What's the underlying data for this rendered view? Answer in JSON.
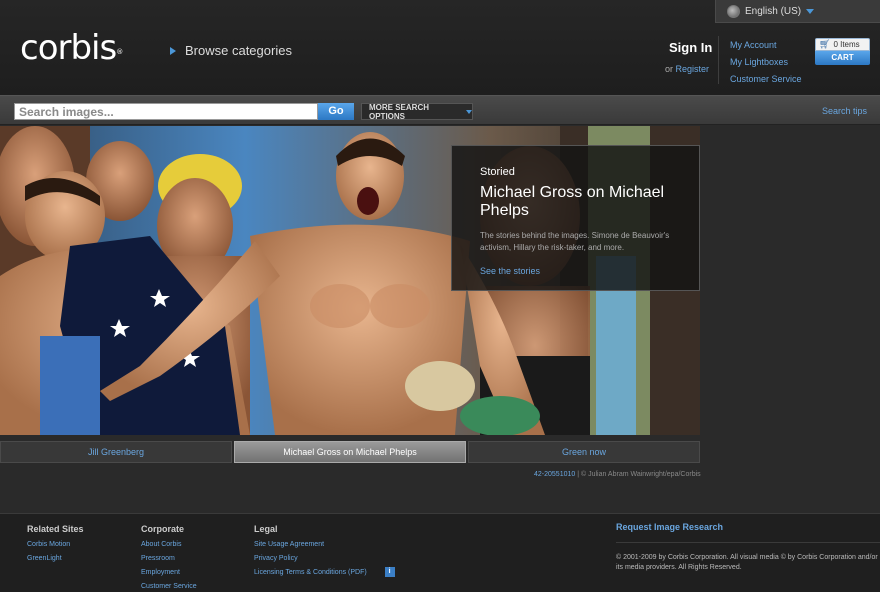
{
  "header": {
    "language": "English (US)",
    "logo_text": "corbis",
    "logo_mark": "®",
    "browse": "Browse categories",
    "sign_in": "Sign In",
    "or": "or",
    "register": "Register",
    "account_links": [
      "My Account",
      "My Lightboxes",
      "Customer Service"
    ],
    "cart_items": "0 Items",
    "cart_label": "CART"
  },
  "search": {
    "placeholder": "Search images...",
    "go": "Go",
    "more_options": "MORE SEARCH OPTIONS",
    "tips": "Search tips"
  },
  "hero": {
    "kicker": "Storied",
    "title": "Michael Gross on Michael Phelps",
    "description": "The stories behind the images. Simone de Beauvoir's activism, Hillary the risk-taker, and more.",
    "link": "See the stories"
  },
  "tabs": [
    {
      "label": "Jill Greenberg",
      "active": false
    },
    {
      "label": "Michael Gross on Michael Phelps",
      "active": true
    },
    {
      "label": "Green now",
      "active": false
    }
  ],
  "credit": {
    "id": "42-20551010",
    "text": " | © Julian Abram Wainwright/epa/Corbis"
  },
  "footer": {
    "related": {
      "heading": "Related Sites",
      "links": [
        "Corbis Motion",
        "GreenLight"
      ]
    },
    "corporate": {
      "heading": "Corporate",
      "links": [
        "About Corbis",
        "Pressroom",
        "Employment",
        "Customer Service"
      ]
    },
    "legal": {
      "heading": "Legal",
      "links": [
        "Site Usage Agreement",
        "Privacy Policy",
        "Licensing Terms & Conditions (PDF)"
      ],
      "info_icon": "i"
    },
    "request": "Request Image Research",
    "copyright": "© 2001-2009 by Corbis Corporation. All visual media © by Corbis Corporation and/or its media providers. All Rights Reserved."
  },
  "colors": {
    "link": "#6aa6df",
    "accent_blue": "#2c78c4",
    "background": "#2a2a2a"
  }
}
